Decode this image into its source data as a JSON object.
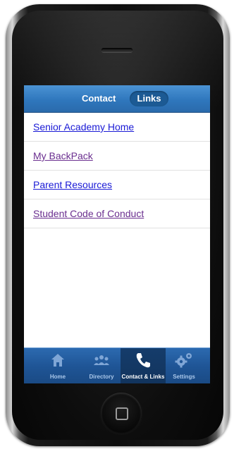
{
  "header": {
    "segments": [
      "Contact",
      "Links"
    ],
    "active_segment": "Links"
  },
  "links": [
    {
      "label": "Senior Academy Home",
      "state": "unvisited"
    },
    {
      "label": "My BackPack",
      "state": "visited"
    },
    {
      "label": "Parent Resources",
      "state": "unvisited"
    },
    {
      "label": "Student Code of Conduct",
      "state": "visited"
    }
  ],
  "tabbar": {
    "tabs": [
      {
        "label": "Home",
        "icon": "home-icon"
      },
      {
        "label": "Directory",
        "icon": "people-icon"
      },
      {
        "label": "Contact & Links",
        "icon": "phone-icon"
      },
      {
        "label": "Settings",
        "icon": "gears-icon"
      }
    ],
    "active": "Contact & Links"
  },
  "colors": {
    "header_blue": "#2f77bd",
    "link_unvisited": "#1a1ad6",
    "link_visited": "#6a2e8f",
    "tabbar_blue": "#1f5596"
  }
}
